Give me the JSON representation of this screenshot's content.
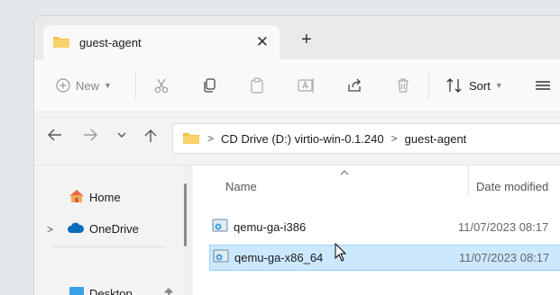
{
  "tab": {
    "title": "guest-agent",
    "close": "✕",
    "add": "+"
  },
  "toolbar": {
    "new_label": "New",
    "sort_label": "Sort"
  },
  "address": {
    "crumbs": [
      "CD Drive (D:) virtio-win-0.1.240",
      "guest-agent"
    ]
  },
  "sidebar": {
    "items": [
      {
        "label": "Home"
      },
      {
        "label": "OneDrive"
      },
      {
        "label": "Desktop"
      }
    ]
  },
  "columns": {
    "name": "Name",
    "date": "Date modified"
  },
  "files": [
    {
      "name": "qemu-ga-i386",
      "date": "11/07/2023 08:17"
    },
    {
      "name": "qemu-ga-x86_64",
      "date": "11/07/2023 08:17",
      "selected": true
    }
  ],
  "colors": {
    "accent": "#0067c0",
    "selection": "#cce8ff",
    "folder": "#f2c14e"
  }
}
